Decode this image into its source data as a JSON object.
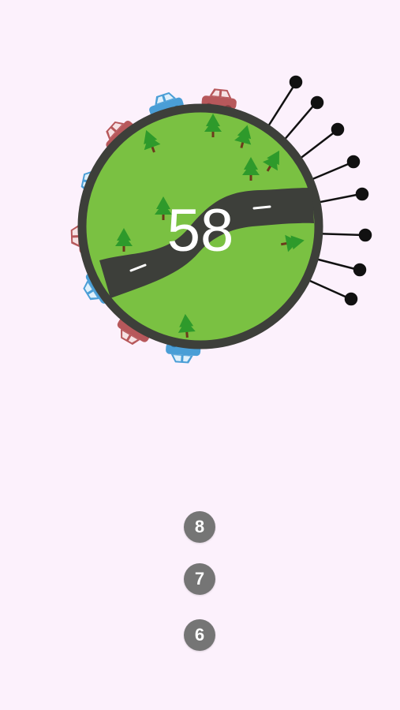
{
  "game": {
    "level_counter": "58",
    "queue_balls": [
      "8",
      "7",
      "6"
    ]
  },
  "colors": {
    "background": "#fcf1fc",
    "planet_ground": "#7ac142",
    "planet_rim": "#3d3f3a",
    "road": "#3d3f3a",
    "road_marking": "#ffffff",
    "tree": "#2e9a2b",
    "tree_trunk": "#6b3a1c",
    "car_red": "#b7585b",
    "car_blue": "#4a9ed6",
    "pin": "#111111",
    "queue_ball": "#757575",
    "counter_text": "#ffffff"
  },
  "icons": [
    "planet-icon",
    "road-icon",
    "tree-icon",
    "car-icon",
    "pin-icon"
  ]
}
